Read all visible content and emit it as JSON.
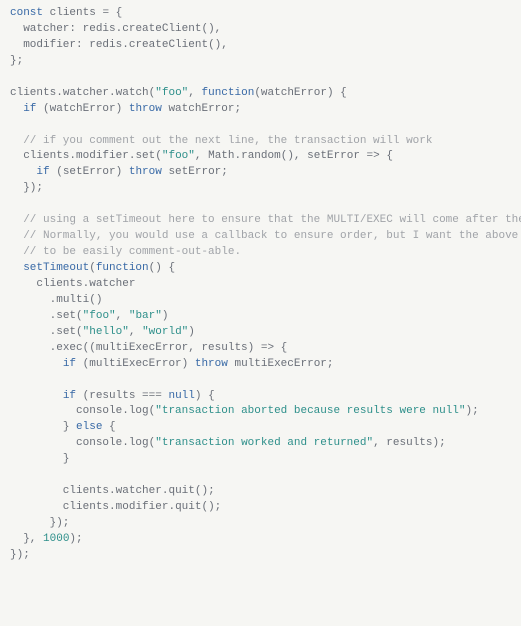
{
  "code": {
    "tokens": [
      [
        [
          "keyword",
          "const"
        ],
        [
          "default",
          " clients "
        ],
        [
          "punct",
          "="
        ],
        [
          "default",
          " "
        ],
        [
          "punct",
          "{"
        ]
      ],
      [
        [
          "default",
          "  watcher"
        ],
        [
          "punct",
          ":"
        ],
        [
          "default",
          " redis"
        ],
        [
          "punct",
          "."
        ],
        [
          "default",
          "createClient"
        ],
        [
          "punct",
          "(),"
        ]
      ],
      [
        [
          "default",
          "  modifier"
        ],
        [
          "punct",
          ":"
        ],
        [
          "default",
          " redis"
        ],
        [
          "punct",
          "."
        ],
        [
          "default",
          "createClient"
        ],
        [
          "punct",
          "(),"
        ]
      ],
      [
        [
          "punct",
          "};"
        ]
      ],
      [
        [
          "default",
          ""
        ]
      ],
      [
        [
          "default",
          "clients"
        ],
        [
          "punct",
          "."
        ],
        [
          "default",
          "watcher"
        ],
        [
          "punct",
          "."
        ],
        [
          "default",
          "watch"
        ],
        [
          "punct",
          "("
        ],
        [
          "string",
          "\"foo\""
        ],
        [
          "punct",
          ", "
        ],
        [
          "keyword",
          "function"
        ],
        [
          "punct",
          "("
        ],
        [
          "default",
          "watchError"
        ],
        [
          "punct",
          ") {"
        ]
      ],
      [
        [
          "default",
          "  "
        ],
        [
          "keyword",
          "if"
        ],
        [
          "default",
          " "
        ],
        [
          "punct",
          "("
        ],
        [
          "default",
          "watchError"
        ],
        [
          "punct",
          ") "
        ],
        [
          "keyword",
          "throw"
        ],
        [
          "default",
          " watchError"
        ],
        [
          "punct",
          ";"
        ]
      ],
      [
        [
          "default",
          ""
        ]
      ],
      [
        [
          "default",
          "  "
        ],
        [
          "comment",
          "// if you comment out the next line, the transaction will work"
        ]
      ],
      [
        [
          "default",
          "  clients"
        ],
        [
          "punct",
          "."
        ],
        [
          "default",
          "modifier"
        ],
        [
          "punct",
          "."
        ],
        [
          "default",
          "set"
        ],
        [
          "punct",
          "("
        ],
        [
          "string",
          "\"foo\""
        ],
        [
          "punct",
          ", "
        ],
        [
          "default",
          "Math"
        ],
        [
          "punct",
          "."
        ],
        [
          "default",
          "random"
        ],
        [
          "punct",
          "(), "
        ],
        [
          "default",
          "setError"
        ],
        [
          "punct",
          " => {"
        ]
      ],
      [
        [
          "default",
          "    "
        ],
        [
          "keyword",
          "if"
        ],
        [
          "default",
          " "
        ],
        [
          "punct",
          "("
        ],
        [
          "default",
          "setError"
        ],
        [
          "punct",
          ") "
        ],
        [
          "keyword",
          "throw"
        ],
        [
          "default",
          " setError"
        ],
        [
          "punct",
          ";"
        ]
      ],
      [
        [
          "default",
          "  "
        ],
        [
          "punct",
          "});"
        ]
      ],
      [
        [
          "default",
          ""
        ]
      ],
      [
        [
          "default",
          "  "
        ],
        [
          "comment",
          "// using a setTimeout here to ensure that the MULTI/EXEC will come after the SET."
        ]
      ],
      [
        [
          "default",
          "  "
        ],
        [
          "comment",
          "// Normally, you would use a callback to ensure order, but I want the above SET command"
        ]
      ],
      [
        [
          "default",
          "  "
        ],
        [
          "comment",
          "// to be easily comment-out-able."
        ]
      ],
      [
        [
          "default",
          "  "
        ],
        [
          "keyword",
          "setTimeout"
        ],
        [
          "punct",
          "("
        ],
        [
          "keyword",
          "function"
        ],
        [
          "punct",
          "() {"
        ]
      ],
      [
        [
          "default",
          "    clients"
        ],
        [
          "punct",
          "."
        ],
        [
          "default",
          "watcher"
        ]
      ],
      [
        [
          "default",
          "      "
        ],
        [
          "punct",
          "."
        ],
        [
          "default",
          "multi"
        ],
        [
          "punct",
          "()"
        ]
      ],
      [
        [
          "default",
          "      "
        ],
        [
          "punct",
          "."
        ],
        [
          "default",
          "set"
        ],
        [
          "punct",
          "("
        ],
        [
          "string",
          "\"foo\""
        ],
        [
          "punct",
          ", "
        ],
        [
          "string",
          "\"bar\""
        ],
        [
          "punct",
          ")"
        ]
      ],
      [
        [
          "default",
          "      "
        ],
        [
          "punct",
          "."
        ],
        [
          "default",
          "set"
        ],
        [
          "punct",
          "("
        ],
        [
          "string",
          "\"hello\""
        ],
        [
          "punct",
          ", "
        ],
        [
          "string",
          "\"world\""
        ],
        [
          "punct",
          ")"
        ]
      ],
      [
        [
          "default",
          "      "
        ],
        [
          "punct",
          "."
        ],
        [
          "default",
          "exec"
        ],
        [
          "punct",
          "(("
        ],
        [
          "default",
          "multiExecError"
        ],
        [
          "punct",
          ", "
        ],
        [
          "default",
          "results"
        ],
        [
          "punct",
          ") => {"
        ]
      ],
      [
        [
          "default",
          "        "
        ],
        [
          "keyword",
          "if"
        ],
        [
          "default",
          " "
        ],
        [
          "punct",
          "("
        ],
        [
          "default",
          "multiExecError"
        ],
        [
          "punct",
          ") "
        ],
        [
          "keyword",
          "throw"
        ],
        [
          "default",
          " multiExecError"
        ],
        [
          "punct",
          ";"
        ]
      ],
      [
        [
          "default",
          ""
        ]
      ],
      [
        [
          "default",
          "        "
        ],
        [
          "keyword",
          "if"
        ],
        [
          "default",
          " "
        ],
        [
          "punct",
          "("
        ],
        [
          "default",
          "results "
        ],
        [
          "punct",
          "==="
        ],
        [
          "default",
          " "
        ],
        [
          "keyword",
          "null"
        ],
        [
          "punct",
          ") {"
        ]
      ],
      [
        [
          "default",
          "          console"
        ],
        [
          "punct",
          "."
        ],
        [
          "default",
          "log"
        ],
        [
          "punct",
          "("
        ],
        [
          "string",
          "\"transaction aborted because results were null\""
        ],
        [
          "punct",
          ");"
        ]
      ],
      [
        [
          "default",
          "        "
        ],
        [
          "punct",
          "} "
        ],
        [
          "keyword",
          "else"
        ],
        [
          "punct",
          " {"
        ]
      ],
      [
        [
          "default",
          "          console"
        ],
        [
          "punct",
          "."
        ],
        [
          "default",
          "log"
        ],
        [
          "punct",
          "("
        ],
        [
          "string",
          "\"transaction worked and returned\""
        ],
        [
          "punct",
          ", "
        ],
        [
          "default",
          "results"
        ],
        [
          "punct",
          ");"
        ]
      ],
      [
        [
          "default",
          "        "
        ],
        [
          "punct",
          "}"
        ]
      ],
      [
        [
          "default",
          ""
        ]
      ],
      [
        [
          "default",
          "        clients"
        ],
        [
          "punct",
          "."
        ],
        [
          "default",
          "watcher"
        ],
        [
          "punct",
          "."
        ],
        [
          "default",
          "quit"
        ],
        [
          "punct",
          "();"
        ]
      ],
      [
        [
          "default",
          "        clients"
        ],
        [
          "punct",
          "."
        ],
        [
          "default",
          "modifier"
        ],
        [
          "punct",
          "."
        ],
        [
          "default",
          "quit"
        ],
        [
          "punct",
          "();"
        ]
      ],
      [
        [
          "default",
          "      "
        ],
        [
          "punct",
          "});"
        ]
      ],
      [
        [
          "default",
          "  "
        ],
        [
          "punct",
          "}, "
        ],
        [
          "number",
          "1000"
        ],
        [
          "punct",
          ");"
        ]
      ],
      [
        [
          "punct",
          "});"
        ]
      ]
    ]
  }
}
